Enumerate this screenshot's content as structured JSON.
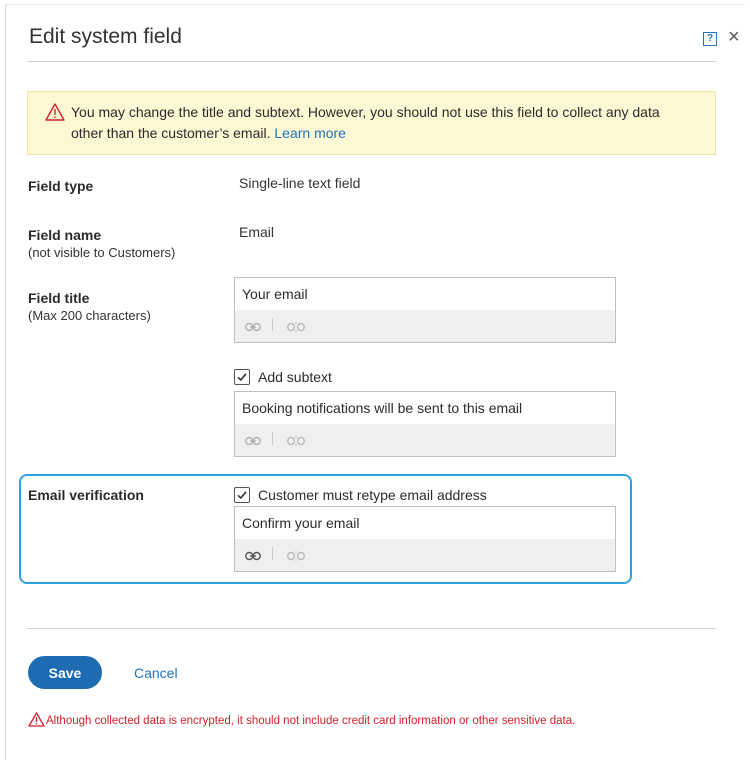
{
  "dialog": {
    "title": "Edit system field",
    "help_icon": "question-help-icon",
    "close_icon": "close-x-icon",
    "help_glyph": "?",
    "close_glyph": "×"
  },
  "alert": {
    "icon": "warning-triangle-icon",
    "text": "You may change the title and subtext. However, you should not use this field to collect any data other than the customer’s email.",
    "link": "Learn more",
    "background": "#fcf8d4"
  },
  "rows": {
    "field_type": {
      "label": "Field type",
      "value": "Single-line text field"
    },
    "field_name": {
      "label": "Field name",
      "sublabel": "(not visible to Customers)",
      "value": "Email"
    },
    "field_title": {
      "label": "Field title",
      "sublabel": "(Max 200 characters)",
      "input_value": "Your email"
    },
    "subtext": {
      "checkbox_label": "Add subtext",
      "checked": true,
      "input_value": "Booking notifications will be sent to this email"
    },
    "email_verification": {
      "label": "Email verification",
      "checkbox_label": "Customer must retype email address",
      "checked": true,
      "input_value": "Confirm your email"
    }
  },
  "toolbar": {
    "link_icon": "link-icon",
    "unlink_icon": "unlink-icon",
    "separator": "|"
  },
  "footer": {
    "save_label": "Save",
    "cancel_label": "Cancel",
    "warning_icon": "warning-triangle-icon",
    "warning_text": "Although collected data is encrypted, it should not include credit card information or other sensitive data."
  },
  "colors": {
    "primary": "#1f6bb1",
    "link": "#1e73be",
    "highlight_border": "#2ca3d8",
    "warning_red": "#d4202a"
  }
}
